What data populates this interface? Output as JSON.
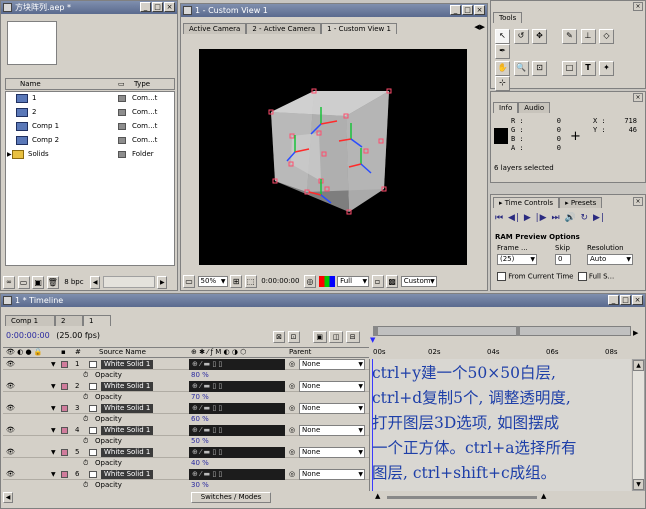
{
  "project": {
    "title": "方块阵列.aep *",
    "columns": {
      "name": "Name",
      "type": "Type"
    },
    "items": [
      {
        "name": "1",
        "type": "Com...t",
        "color": "#8d8d8d"
      },
      {
        "name": "2",
        "type": "Com...t",
        "color": "#8d8d8d"
      },
      {
        "name": "Comp 1",
        "type": "Com...t",
        "color": "#8d8d8d"
      },
      {
        "name": "Comp 2",
        "type": "Com...t",
        "color": "#8d8d8d"
      },
      {
        "name": "Solids",
        "type": "Folder",
        "color": "#8d8d8d"
      }
    ],
    "bpc": "8 bpc"
  },
  "viewer": {
    "title": "1 - Custom View 1",
    "tabs": [
      "Active Camera",
      "2 - Active Camera",
      "1 - Custom View 1"
    ],
    "zoom": "50%",
    "timecode": "0:00:00:00",
    "resolution": "Full",
    "view": "Custom"
  },
  "tools": {
    "title": "Tools"
  },
  "info": {
    "tabs": [
      "Info",
      "Audio"
    ],
    "r": "R :",
    "g": "G :",
    "b": "B :",
    "a": "A :",
    "r_val": "0",
    "g_val": "0",
    "b_val": "0",
    "a_val": "0",
    "x": "X :",
    "y": "Y :",
    "x_val": "718",
    "y_val": "46",
    "status": "6 layers selected"
  },
  "time_controls": {
    "tabs": [
      "Time Controls",
      "Presets"
    ],
    "ram_preview": "RAM Preview Options",
    "frame_rate_label": "Frame ...",
    "skip_label": "Skip",
    "resolution_label": "Resolution",
    "frame_rate": "(25)",
    "skip": "0",
    "resolution": "Auto",
    "from_current": "From Current Time",
    "full_screen": "Full S..."
  },
  "timeline": {
    "title": "1 * Timeline",
    "tabs": [
      "Comp 1",
      "2",
      "1"
    ],
    "timecode": "0:00:00:00",
    "fps": "(25.00 fps)",
    "col_num": "#",
    "col_source": "Source Name",
    "col_parent": "Parent",
    "ruler": [
      "00s",
      "02s",
      "04s",
      "06s",
      "08s"
    ],
    "switches_modes": "Switches / Modes",
    "opacity_label": "Opacity",
    "layers": [
      {
        "num": "1",
        "name": "White Solid 1",
        "parent": "None",
        "opacity": "80"
      },
      {
        "num": "2",
        "name": "White Solid 1",
        "parent": "None",
        "opacity": "70"
      },
      {
        "num": "3",
        "name": "White Solid 1",
        "parent": "None",
        "opacity": "60"
      },
      {
        "num": "4",
        "name": "White Solid 1",
        "parent": "None",
        "opacity": "50"
      },
      {
        "num": "5",
        "name": "White Solid 1",
        "parent": "None",
        "opacity": "40"
      },
      {
        "num": "6",
        "name": "White Solid 1",
        "parent": "None",
        "opacity": "30"
      }
    ],
    "percent": "%"
  },
  "annotation": {
    "lines": [
      "ctrl+y建一个50×50白层,",
      "ctrl+d复制5个, 调整透明度,",
      "打开图层3D选项, 如图摆成",
      "一个正方体。ctrl+a选择所有",
      "图层, ctrl+shift+c成组。"
    ],
    "color": "#1e3fa8"
  }
}
